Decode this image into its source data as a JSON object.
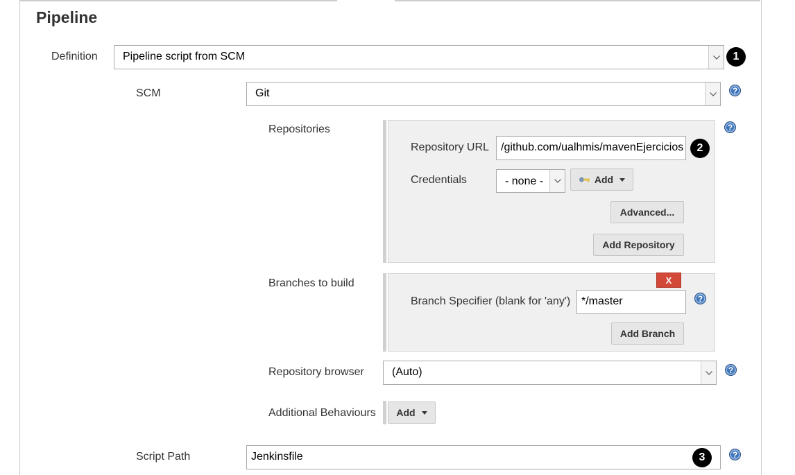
{
  "section": {
    "title": "Pipeline"
  },
  "definition": {
    "label": "Definition",
    "value": "Pipeline script from SCM",
    "badge": "1"
  },
  "scm": {
    "label": "SCM",
    "value": "Git"
  },
  "repositories": {
    "label": "Repositories",
    "url_label": "Repository URL",
    "url_value": "/github.com/ualhmis/mavenEjercicios",
    "url_badge": "2",
    "credentials_label": "Credentials",
    "credentials_value": "- none -",
    "add_label": "Add",
    "advanced_label": "Advanced...",
    "add_repository_label": "Add Repository"
  },
  "branches": {
    "label": "Branches to build",
    "delete_label": "X",
    "specifier_label": "Branch Specifier (blank for 'any')",
    "specifier_value": "*/master",
    "add_branch_label": "Add Branch"
  },
  "repo_browser": {
    "label": "Repository browser",
    "value": "(Auto)"
  },
  "behaviours": {
    "label": "Additional Behaviours",
    "add_label": "Add"
  },
  "script_path": {
    "label": "Script Path",
    "value": "Jenkinsfile",
    "badge": "3"
  },
  "help_glyph": "?",
  "colors": {
    "help": "#3f74b8",
    "delete": "#d24939",
    "badge": "#000000"
  }
}
